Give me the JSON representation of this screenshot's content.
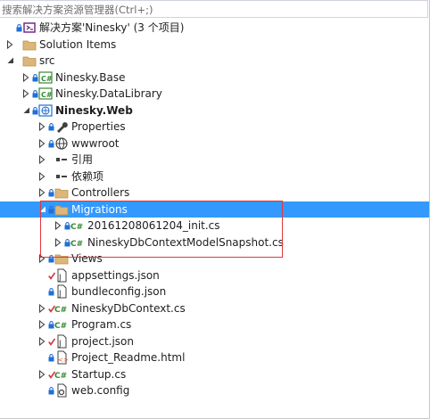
{
  "search": {
    "placeholder": "搜索解决方案资源管理器(Ctrl+;)"
  },
  "tree": [
    {
      "label": "解决方案'Ninesky' (3 个项目)",
      "icon": "solution-icon",
      "level": 0,
      "expander": "none",
      "marks": "lock",
      "bold": false,
      "name": "tree-item-solution"
    },
    {
      "label": "Solution Items",
      "icon": "folder-icon",
      "level": 0,
      "expander": "collapsed",
      "marks": "",
      "bold": false,
      "name": "tree-item-solution-items"
    },
    {
      "label": "src",
      "icon": "folder-icon",
      "level": 0,
      "expander": "expanded",
      "marks": "",
      "bold": false,
      "name": "tree-item-src"
    },
    {
      "label": "Ninesky.Base",
      "icon": "csharp-project-icon",
      "level": 1,
      "expander": "collapsed",
      "marks": "lock",
      "bold": false,
      "name": "tree-item-ninesky-base"
    },
    {
      "label": "Ninesky.DataLibrary",
      "icon": "csharp-project-icon",
      "level": 1,
      "expander": "collapsed",
      "marks": "lock",
      "bold": false,
      "name": "tree-item-ninesky-datalibrary"
    },
    {
      "label": "Ninesky.Web",
      "icon": "web-project-icon",
      "level": 1,
      "expander": "expanded",
      "marks": "lock",
      "bold": true,
      "name": "tree-item-ninesky-web"
    },
    {
      "label": "Properties",
      "icon": "wrench-icon",
      "level": 2,
      "expander": "collapsed",
      "marks": "lock",
      "bold": false,
      "name": "tree-item-properties"
    },
    {
      "label": "wwwroot",
      "icon": "globe-icon",
      "level": 2,
      "expander": "collapsed",
      "marks": "lock",
      "bold": false,
      "name": "tree-item-wwwroot"
    },
    {
      "label": "引用",
      "icon": "references-icon",
      "level": 2,
      "expander": "collapsed",
      "marks": "",
      "bold": false,
      "name": "tree-item-references"
    },
    {
      "label": "依赖项",
      "icon": "references-icon",
      "level": 2,
      "expander": "collapsed",
      "marks": "",
      "bold": false,
      "name": "tree-item-dependencies"
    },
    {
      "label": "Controllers",
      "icon": "folder-icon",
      "level": 2,
      "expander": "collapsed",
      "marks": "lock",
      "bold": false,
      "name": "tree-item-controllers"
    },
    {
      "label": "Migrations",
      "icon": "folder-icon",
      "level": 2,
      "expander": "expanded",
      "marks": "lock",
      "bold": false,
      "selected": true,
      "name": "tree-item-migrations"
    },
    {
      "label": "20161208061204_init.cs",
      "icon": "csharp-file-icon",
      "level": 3,
      "expander": "collapsed",
      "marks": "lock",
      "bold": false,
      "name": "tree-item-init-cs"
    },
    {
      "label": "NineskyDbContextModelSnapshot.cs",
      "icon": "csharp-file-icon",
      "level": 3,
      "expander": "collapsed",
      "marks": "lock",
      "bold": false,
      "name": "tree-item-snapshot-cs"
    },
    {
      "label": "Views",
      "icon": "folder-icon",
      "level": 2,
      "expander": "collapsed",
      "marks": "lock",
      "bold": false,
      "name": "tree-item-views"
    },
    {
      "label": "appsettings.json",
      "icon": "json-file-icon",
      "level": 2,
      "expander": "none",
      "marks": "check",
      "bold": false,
      "name": "tree-item-appsettings"
    },
    {
      "label": "bundleconfig.json",
      "icon": "json-file-icon",
      "level": 2,
      "expander": "none",
      "marks": "lock",
      "bold": false,
      "name": "tree-item-bundleconfig"
    },
    {
      "label": "NineskyDbContext.cs",
      "icon": "csharp-file-icon",
      "level": 2,
      "expander": "collapsed",
      "marks": "check",
      "bold": false,
      "name": "tree-item-dbcontext-cs"
    },
    {
      "label": "Program.cs",
      "icon": "csharp-file-icon",
      "level": 2,
      "expander": "collapsed",
      "marks": "lock",
      "bold": false,
      "name": "tree-item-program-cs"
    },
    {
      "label": "project.json",
      "icon": "json-file-icon",
      "level": 2,
      "expander": "collapsed",
      "marks": "check",
      "bold": false,
      "name": "tree-item-project-json"
    },
    {
      "label": "Project_Readme.html",
      "icon": "html-file-icon",
      "level": 2,
      "expander": "none",
      "marks": "lock",
      "bold": false,
      "name": "tree-item-readme"
    },
    {
      "label": "Startup.cs",
      "icon": "csharp-file-icon",
      "level": 2,
      "expander": "collapsed",
      "marks": "check",
      "bold": false,
      "name": "tree-item-startup-cs"
    },
    {
      "label": "web.config",
      "icon": "config-file-icon",
      "level": 2,
      "expander": "none",
      "marks": "lock",
      "bold": false,
      "name": "tree-item-web-config"
    }
  ],
  "colors": {
    "selection": "#3399ff",
    "folder": "#dcb67a",
    "lock": "#1f6fd6",
    "check": "#d13438",
    "csharp": "#368832",
    "highlight_box": "#e0383c"
  }
}
